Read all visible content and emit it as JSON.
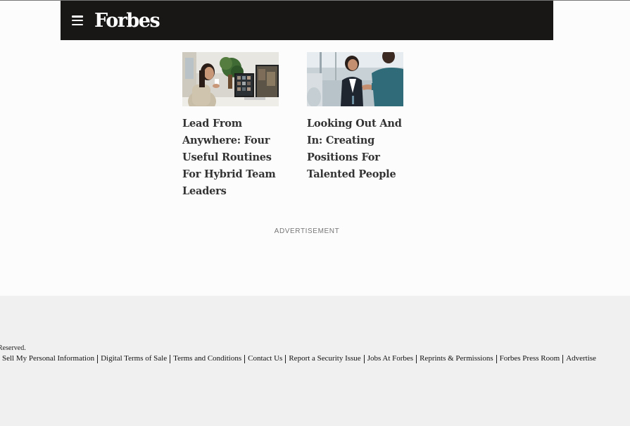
{
  "header": {
    "logo": "Forbes",
    "menu_icon": "hamburger-menu-icon",
    "background": "#181716"
  },
  "articles": [
    {
      "headline": "Lead From Anywhere: Four Useful Routines For Hybrid Team Leaders",
      "image": "woman-at-desk-video-call-photo"
    },
    {
      "headline": "Looking Out And In: Creating Positions For Talented People",
      "image": "business-handshake-photo"
    }
  ],
  "ad": {
    "label": "ADVERTISEMENT"
  },
  "footer": {
    "rights": "Reserved.",
    "links": [
      "Sell My Personal Information",
      "Digital Terms of Sale",
      "Terms and Conditions",
      "Contact Us",
      "Report a Security Issue",
      "Jobs At Forbes",
      "Reprints & Permissions",
      "Forbes Press Room",
      "Advertise"
    ]
  }
}
